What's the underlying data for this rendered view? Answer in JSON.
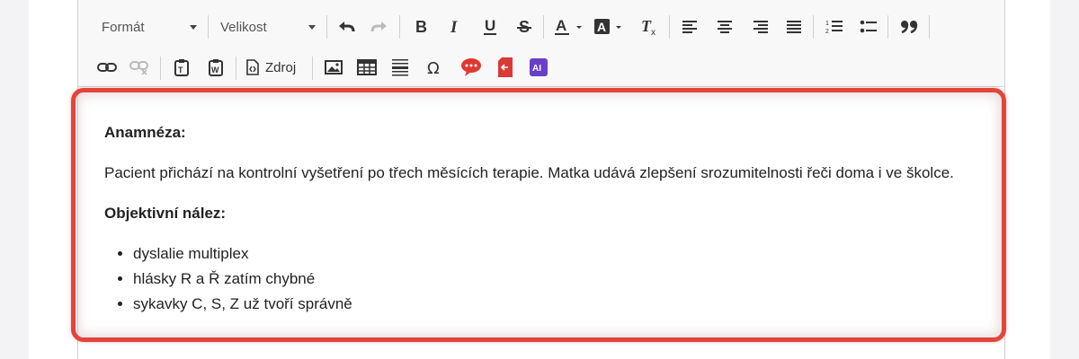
{
  "toolbar": {
    "format_label": "Formát",
    "size_label": "Velikost",
    "source_label": "Zdroj",
    "row1_icons": [
      "undo-icon",
      "redo-icon",
      "bold-icon",
      "italic-icon",
      "underline-icon",
      "strikethrough-icon",
      "text-color-icon",
      "background-color-icon",
      "remove-format-icon",
      "align-left-icon",
      "align-center-icon",
      "align-right-icon",
      "align-justify-icon",
      "numbered-list-icon",
      "bulleted-list-icon",
      "blockquote-icon"
    ],
    "row2_icons": [
      "link-icon",
      "unlink-icon",
      "paste-text-icon",
      "paste-word-icon",
      "source-icon",
      "image-icon",
      "table-icon",
      "horizontal-line-icon",
      "special-char-icon",
      "comment-icon",
      "pdf-export-icon",
      "ai-icon"
    ],
    "ai_badge": "AI",
    "colors": {
      "highlight_border": "#e2453c",
      "comment": "#e0392f",
      "pdf": "#d93a35",
      "ai": "#6a3fc7"
    }
  },
  "document": {
    "heading1": "Anamnéza:",
    "paragraph1": "Pacient přichází na kontrolní vyšetření po třech měsících terapie. Matka udává zlepšení srozumitelnosti řeči doma i ve školce.",
    "heading2": "Objektivní nález:",
    "findings": [
      "dyslalie multiplex",
      "hlásky R a Ř zatím chybné",
      "sykavky C, S, Z už tvoří správně"
    ]
  }
}
